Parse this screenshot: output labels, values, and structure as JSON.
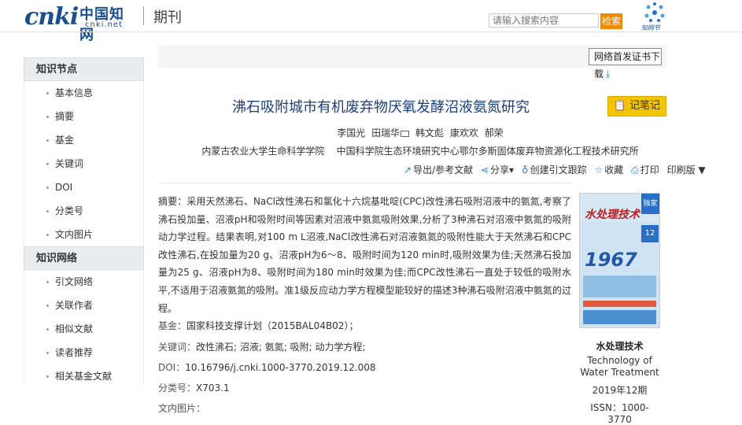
{
  "header": {
    "logo_text": "cnki",
    "logo_cn": "中国知网",
    "logo_url": "cnki.net",
    "section_title": "期刊",
    "search_placeholder": "请输入搜索内容",
    "search_button": "检索",
    "zhiwang_label": "知网节"
  },
  "sidebar": {
    "sections": [
      {
        "title": "知识节点",
        "items": [
          "基本信息",
          "摘要",
          "基金",
          "关键词",
          "DOI",
          "分类号",
          "文内图片"
        ]
      },
      {
        "title": "知识网络",
        "items": [
          "引文网络",
          "关联作者",
          "相似文献",
          "读者推荐",
          "相关基金文献"
        ]
      }
    ]
  },
  "topbar": {
    "cert_button": "网络首发证书下",
    "cert_button_cont": "载"
  },
  "article": {
    "title": "沸石吸附城市有机废弃物厌氧发酵沼液氨氮研究",
    "note_button": "记笔记",
    "authors": [
      "李国光",
      "田瑞华",
      "韩文彪",
      "康欢欢",
      "郝荣"
    ],
    "affiliations": [
      "内蒙古农业大学生命科学学院",
      "中国科学院生态环境研究中心鄂尔多斯固体废弃物资源化工程技术研究所"
    ],
    "actions": [
      "导出/参考文献",
      "分享",
      "创建引文跟踪",
      "收藏",
      "打印",
      "印刷版"
    ],
    "abstract_label": "摘要：",
    "abstract": "采用天然沸石、NaCl改性沸石和氯化十六烷基吡啶(CPC)改性沸石吸附沼液中的氨氮,考察了沸石投加量、沼液pH和吸附时间等因素对沼液中氨氮吸附效果,分析了3种沸石对沼液中氨氮的吸附动力学过程。结果表明,对100 m L沼液,NaCl改性沸石对沼液氨氮的吸附性能大于天然沸石和CPC改性沸石,在投加量为20 g、沼液pH为6～8、吸附时间为120 min时,吸附效果为佳;天然沸石投加量为25 g、沼液pH为8、吸附时间为180 min时效果为佳;而CPC改性沸石一直处于较低的吸附水平,不适用于沼液氨氮的吸附。准1级反应动力学方程模型能较好的描述3种沸石吸附沼液中氨氮的过程。",
    "fund_label": "基金：",
    "fund": "国家科技支撑计划（2015BAL04B02）；",
    "keywords_label": "关键词：",
    "keywords": "改性沸石; 沼液; 氨氮; 吸附; 动力学方程;",
    "doi_label": "DOI：",
    "doi": "10.16796/j.cnki.1000-3770.2019.12.008",
    "class_label": "分类号：",
    "class": "X703.1",
    "images_label": "文内图片："
  },
  "journal": {
    "cover_name": "水处理技术",
    "cover_badge": "独家",
    "cover_num": "12",
    "cover_year": "1967",
    "name": "水处理技术",
    "name_en": "Technology of Water Treatment",
    "issue": "2019年12期",
    "issn": "ISSN：1000-3770"
  }
}
